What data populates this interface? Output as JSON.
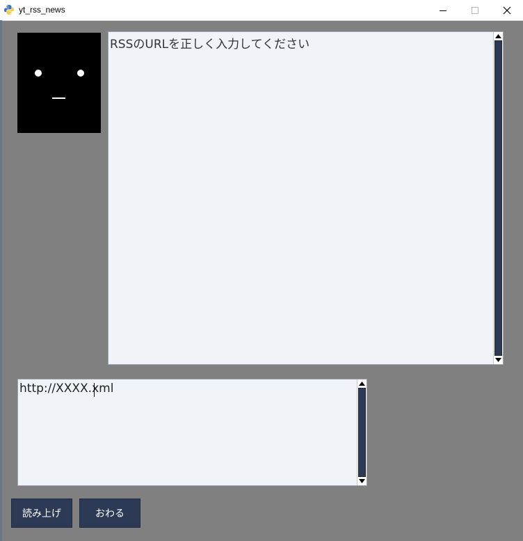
{
  "window": {
    "title": "yt_rss_news"
  },
  "colors": {
    "background": "#808080",
    "button_bg": "#2c3a56",
    "button_text": "#ffffff",
    "textbox_bg": "#f0f4f9",
    "avatar_bg": "#000000"
  },
  "avatar": {
    "icon": "face-icon"
  },
  "output": {
    "text": "RSSのURLを正しく入力してください"
  },
  "input": {
    "value": "http://XXXX.xml"
  },
  "buttons": {
    "read_label": "読み上げ",
    "end_label": "おわる"
  }
}
